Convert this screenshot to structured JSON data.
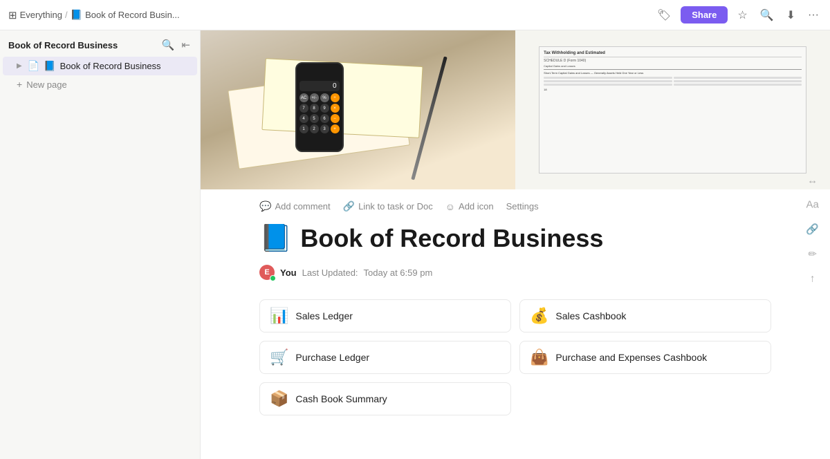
{
  "topbar": {
    "app_label": "Everything",
    "separator": "/",
    "page_icon": "📘",
    "page_title_short": "Book of Record Busin...",
    "share_label": "Share"
  },
  "sidebar": {
    "title": "Book of Record Business",
    "items": [
      {
        "id": "book-of-record",
        "icon": "📘",
        "label": "Book of Record Business",
        "active": true
      }
    ],
    "new_page_label": "New page"
  },
  "page": {
    "emoji": "📘",
    "title": "Book of Record Business",
    "toolbar": {
      "add_comment": "Add comment",
      "link_to_task": "Link to task or Doc",
      "add_icon": "Add icon",
      "settings": "Settings"
    },
    "meta": {
      "user_initial": "E",
      "user_label": "You",
      "last_updated_label": "Last Updated:",
      "last_updated_value": "Today at 6:59 pm"
    },
    "doc_items": [
      {
        "icon": "📊",
        "label": "Sales Ledger"
      },
      {
        "icon": "💰",
        "label": "Sales Cashbook"
      },
      {
        "icon": "🛒",
        "label": "Purchase Ledger"
      },
      {
        "icon": "👜",
        "label": "Purchase and Expenses Cashbook"
      },
      {
        "icon": "📦",
        "label": "Cash Book Summary"
      }
    ]
  }
}
